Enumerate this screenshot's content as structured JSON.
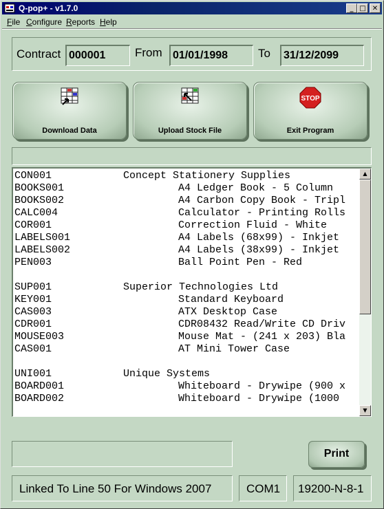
{
  "window": {
    "title": "Q-pop+ - v1.7.0",
    "controls": {
      "minimize": "_",
      "maximize": "□",
      "close": "✕"
    }
  },
  "menu": [
    "File",
    "Configure",
    "Reports",
    "Help"
  ],
  "contract": {
    "contract_label": "Contract",
    "contract_value": "000001",
    "from_label": "From",
    "from_value": "01/01/1998",
    "to_label": "To",
    "to_value": "31/12/2099"
  },
  "actions": {
    "download": {
      "label": "Download Data",
      "icon": "download-data-icon"
    },
    "upload": {
      "label": "Upload Stock File",
      "icon": "upload-stock-icon"
    },
    "exit": {
      "label": "Exit Program",
      "icon": "stop-sign-icon",
      "icon_text": "STOP"
    }
  },
  "stock_list": [
    {
      "code": "CON001",
      "desc": "Concept Stationery Supplies",
      "type": "supplier"
    },
    {
      "code": "BOOKS001",
      "desc": "A4 Ledger Book - 5 Column",
      "type": "item"
    },
    {
      "code": "BOOKS002",
      "desc": "A4 Carbon Copy Book - Tripl",
      "type": "item"
    },
    {
      "code": "CALC004",
      "desc": "Calculator - Printing Rolls",
      "type": "item"
    },
    {
      "code": "COR001",
      "desc": "Correction Fluid - White",
      "type": "item"
    },
    {
      "code": "LABELS001",
      "desc": "A4 Labels (68x99) - Inkjet",
      "type": "item"
    },
    {
      "code": "LABELS002",
      "desc": "A4 Labels (38x99) - Inkjet",
      "type": "item"
    },
    {
      "code": "PEN003",
      "desc": "Ball Point Pen - Red",
      "type": "item"
    },
    {
      "code": "",
      "desc": "",
      "type": "blank"
    },
    {
      "code": "SUP001",
      "desc": "Superior Technologies Ltd",
      "type": "supplier"
    },
    {
      "code": "KEY001",
      "desc": "Standard Keyboard",
      "type": "item"
    },
    {
      "code": "CAS003",
      "desc": "ATX Desktop Case",
      "type": "item"
    },
    {
      "code": "CDR001",
      "desc": "CDR08432 Read/Write CD Driv",
      "type": "item"
    },
    {
      "code": "MOUSE003",
      "desc": "Mouse Mat - (241 x 203) Bla",
      "type": "item"
    },
    {
      "code": "CAS001",
      "desc": "AT Mini Tower Case",
      "type": "item"
    },
    {
      "code": "",
      "desc": "",
      "type": "blank"
    },
    {
      "code": "UNI001",
      "desc": "Unique Systems",
      "type": "supplier"
    },
    {
      "code": "BOARD001",
      "desc": "Whiteboard - Drywipe (900 x",
      "type": "item"
    },
    {
      "code": "BOARD002",
      "desc": "Whiteboard - Drywipe (1000",
      "type": "item"
    }
  ],
  "print_label": "Print",
  "status": {
    "link": "Linked To Line 50 For Windows 2007",
    "port": "COM1",
    "settings": "19200-N-8-1"
  },
  "colors": {
    "window_bg": "#c4d8c4",
    "titlebar": "#0a246a",
    "stop_red": "#d42020"
  }
}
